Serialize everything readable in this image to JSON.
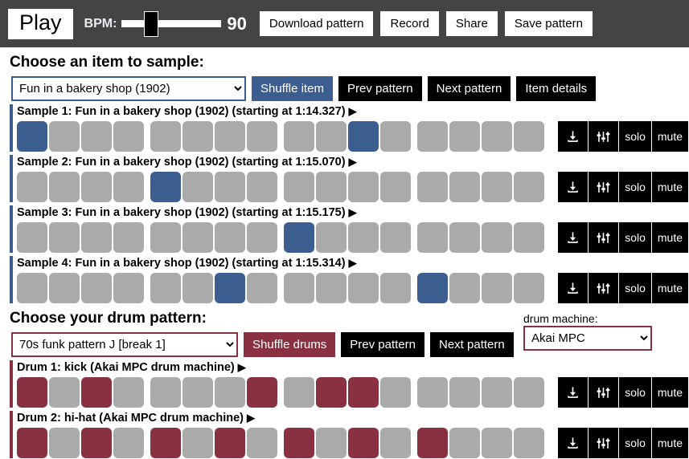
{
  "toolbar": {
    "play_label": "Play",
    "bpm_label": "BPM:",
    "bpm_value": "90",
    "buttons": [
      {
        "label": "Download pattern",
        "name": "download-pattern-button"
      },
      {
        "label": "Record",
        "name": "record-button"
      },
      {
        "label": "Share",
        "name": "share-button"
      },
      {
        "label": "Save pattern",
        "name": "save-pattern-button"
      }
    ]
  },
  "sample_section": {
    "title": "Choose an item to sample:",
    "selected_item": "Fun in a bakery shop (1902)",
    "shuffle_label": "Shuffle item",
    "prev_label": "Prev pattern",
    "next_label": "Next pattern",
    "details_label": "Item details"
  },
  "drum_section": {
    "title": "Choose your drum pattern:",
    "selected_pattern": "70s funk pattern J [break 1]",
    "shuffle_label": "Shuffle drums",
    "prev_label": "Prev pattern",
    "next_label": "Next pattern",
    "machine_label": "drum machine:",
    "selected_machine": "Akai MPC"
  },
  "row_actions": {
    "download_icon": "download-icon",
    "mixer_icon": "sliders-icon",
    "solo_label": "solo",
    "mute_label": "mute"
  },
  "play_marker": "▶",
  "colors": {
    "accent_blue": "#3c5d8f",
    "accent_red": "#8a3141",
    "cell_off": "#aaaaaa",
    "toolbar_bg": "#444444"
  },
  "steps_per_row": 16,
  "tracks": [
    {
      "name": "sample-track-1",
      "label": "Sample 1: Fun in a bakery shop (1902) (starting at 1:14.327)",
      "kind": "sample",
      "steps": [
        1,
        0,
        0,
        0,
        0,
        0,
        0,
        0,
        0,
        0,
        1,
        0,
        0,
        0,
        0,
        0
      ]
    },
    {
      "name": "sample-track-2",
      "label": "Sample 2: Fun in a bakery shop (1902) (starting at 1:15.070)",
      "kind": "sample",
      "steps": [
        0,
        0,
        0,
        0,
        1,
        0,
        0,
        0,
        0,
        0,
        0,
        0,
        0,
        0,
        0,
        0
      ]
    },
    {
      "name": "sample-track-3",
      "label": "Sample 3: Fun in a bakery shop (1902) (starting at 1:15.175)",
      "kind": "sample",
      "steps": [
        0,
        0,
        0,
        0,
        0,
        0,
        0,
        0,
        1,
        0,
        0,
        0,
        0,
        0,
        0,
        0
      ]
    },
    {
      "name": "sample-track-4",
      "label": "Sample 4: Fun in a bakery shop (1902) (starting at 1:15.314)",
      "kind": "sample",
      "steps": [
        0,
        0,
        0,
        0,
        0,
        0,
        1,
        0,
        0,
        0,
        0,
        0,
        1,
        0,
        0,
        0
      ]
    }
  ],
  "drum_tracks": [
    {
      "name": "drum-track-1",
      "label": "Drum 1: kick (Akai MPC drum machine)",
      "kind": "drum",
      "steps": [
        1,
        0,
        1,
        0,
        0,
        0,
        0,
        1,
        0,
        1,
        1,
        0,
        0,
        0,
        0,
        0
      ]
    },
    {
      "name": "drum-track-2",
      "label": "Drum 2: hi-hat (Akai MPC drum machine)",
      "kind": "drum",
      "steps": [
        1,
        0,
        1,
        0,
        1,
        0,
        1,
        0,
        1,
        0,
        1,
        0,
        1,
        0,
        0,
        0
      ]
    }
  ]
}
